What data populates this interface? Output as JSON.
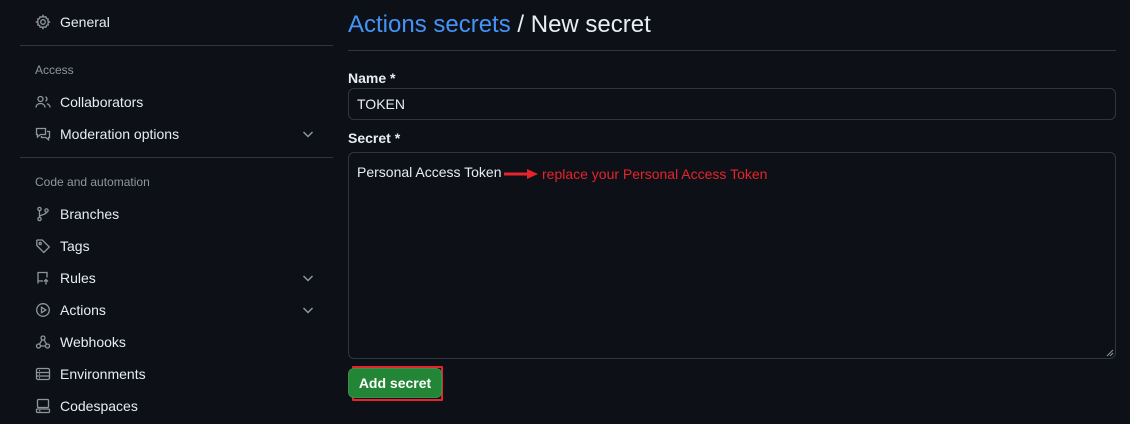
{
  "sidebar": {
    "general": "General",
    "access_section": "Access",
    "collaborators": "Collaborators",
    "moderation": "Moderation options",
    "code_section": "Code and automation",
    "branches": "Branches",
    "tags": "Tags",
    "rules": "Rules",
    "actions": "Actions",
    "webhooks": "Webhooks",
    "environments": "Environments",
    "codespaces": "Codespaces"
  },
  "header": {
    "breadcrumb": "Actions secrets",
    "separator": "/",
    "current": "New secret"
  },
  "form": {
    "name_label": "Name *",
    "name_value": "TOKEN",
    "secret_label": "Secret *",
    "secret_value": "Personal Access Token",
    "submit_label": "Add secret"
  },
  "annotation": {
    "text": "replace your Personal Access Token",
    "color": "#e5242b"
  },
  "colors": {
    "background": "#0d1117",
    "link": "#4493f8",
    "button": "#238636",
    "border": "#30363d"
  }
}
